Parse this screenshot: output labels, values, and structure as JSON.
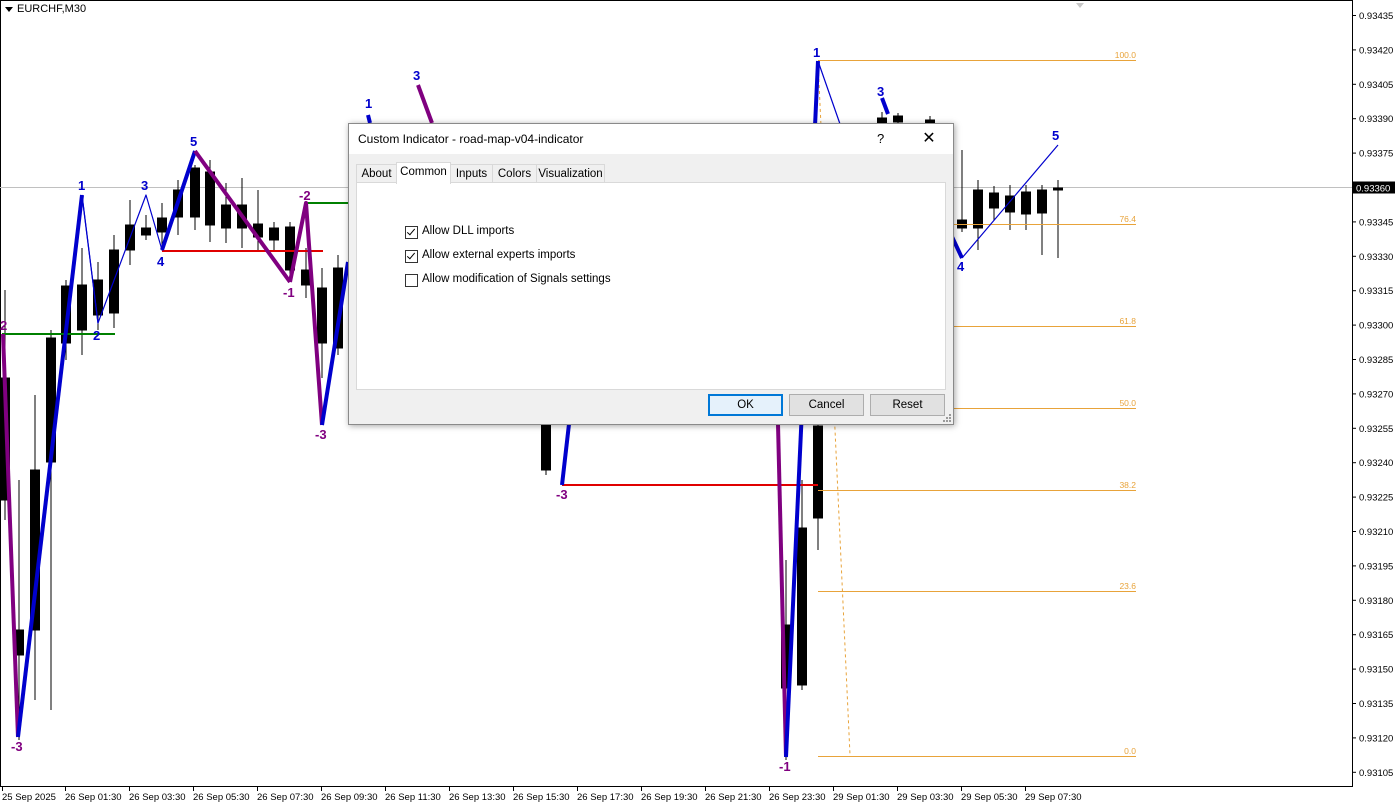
{
  "chart": {
    "symbol": "EURCHF,M30",
    "current_price_label": "0.93360",
    "price_labels": [
      "0.93435",
      "0.93420",
      "0.93405",
      "0.93390",
      "0.93375",
      "0.93345",
      "0.93330",
      "0.93315",
      "0.93300",
      "0.93285",
      "0.93270",
      "0.93255",
      "0.93240",
      "0.93225",
      "0.93210",
      "0.93195",
      "0.93180",
      "0.93165",
      "0.93150",
      "0.93135",
      "0.93120",
      "0.93105"
    ],
    "time_labels": [
      "25 Sep 2025",
      "26 Sep 01:30",
      "26 Sep 03:30",
      "26 Sep 05:30",
      "26 Sep 07:30",
      "26 Sep 09:30",
      "26 Sep 11:30",
      "26 Sep 13:30",
      "26 Sep 15:30",
      "26 Sep 17:30",
      "26 Sep 19:30",
      "26 Sep 21:30",
      "26 Sep 23:30",
      "29 Sep 01:30",
      "29 Sep 03:30",
      "29 Sep 05:30",
      "29 Sep 07:30"
    ],
    "fib_levels": [
      "100.0",
      "76.4",
      "61.8",
      "50.0",
      "38.2",
      "23.6",
      "0.0"
    ],
    "wave_labels": [
      {
        "text": "2",
        "color": "#800080"
      },
      {
        "text": "-3",
        "color": "#800080"
      },
      {
        "text": "1",
        "color": "#0000cd"
      },
      {
        "text": "2",
        "color": "#0000cd"
      },
      {
        "text": "3",
        "color": "#0000cd"
      },
      {
        "text": "4",
        "color": "#0000cd"
      },
      {
        "text": "5",
        "color": "#0000cd"
      },
      {
        "text": "-2",
        "color": "#800080"
      },
      {
        "text": "-1",
        "color": "#800080"
      },
      {
        "text": "-3",
        "color": "#800080"
      },
      {
        "text": "1",
        "color": "#0000cd"
      },
      {
        "text": "3",
        "color": "#0000cd"
      },
      {
        "text": "-3",
        "color": "#800080"
      },
      {
        "text": "-1",
        "color": "#800080"
      },
      {
        "text": "1",
        "color": "#0000cd"
      },
      {
        "text": "3",
        "color": "#0000cd"
      },
      {
        "text": "4",
        "color": "#0000cd"
      },
      {
        "text": "5",
        "color": "#0000cd"
      }
    ],
    "colors": {
      "up_wave": "#0000cd",
      "down_wave": "#800080",
      "fib": "#e8a33a",
      "support": "#008000",
      "resistance": "#e00000"
    }
  },
  "dialog": {
    "title": "Custom Indicator - road-map-v04-indicator",
    "help": "?",
    "close": "✕",
    "tabs": [
      "About",
      "Common",
      "Inputs",
      "Colors",
      "Visualization"
    ],
    "active_tab": "Common",
    "options": [
      {
        "label": "Allow DLL imports",
        "checked": true
      },
      {
        "label": "Allow external experts imports",
        "checked": true
      },
      {
        "label": "Allow modification of Signals settings",
        "checked": false
      }
    ],
    "buttons": {
      "ok": "OK",
      "cancel": "Cancel",
      "reset": "Reset"
    }
  }
}
